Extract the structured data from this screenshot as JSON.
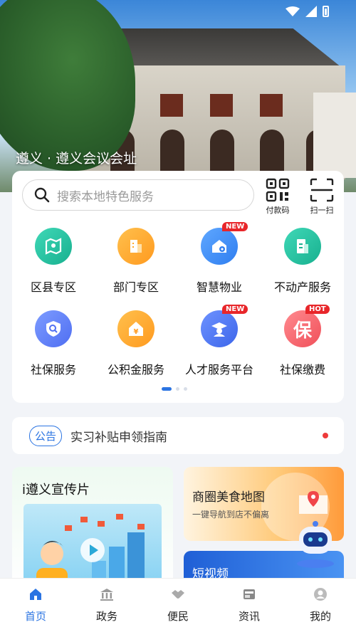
{
  "hero": {
    "caption": "遵义 · 遵义会议会址"
  },
  "search": {
    "placeholder": "搜索本地特色服务"
  },
  "tools": [
    {
      "label": "付款码",
      "icon": "qr-code-icon"
    },
    {
      "label": "扫一扫",
      "icon": "scan-icon"
    }
  ],
  "services": [
    {
      "label": "区县专区",
      "icon": "map-icon",
      "color": "#22c1a0"
    },
    {
      "label": "部门专区",
      "icon": "building-icon",
      "color": "#ffa726"
    },
    {
      "label": "智慧物业",
      "icon": "smart-property-icon",
      "color": "#3d8ef2",
      "badge": "NEW"
    },
    {
      "label": "不动产服务",
      "icon": "property-doc-icon",
      "color": "#22c1a0"
    },
    {
      "label": "社保服务",
      "icon": "shield-search-icon",
      "color": "#5b7ef5"
    },
    {
      "label": "公积金服务",
      "icon": "house-yen-icon",
      "color": "#ffa726"
    },
    {
      "label": "人才服务平台",
      "icon": "graduate-icon",
      "color": "#4a78f0",
      "badge": "NEW"
    },
    {
      "label": "社保缴费",
      "icon": "bao-icon",
      "color": "#f5606a",
      "badge": "HOT",
      "glyph": "保"
    }
  ],
  "notice": {
    "tag": "公告",
    "text": "实习补贴申领指南"
  },
  "promos": {
    "video": {
      "title": "i遵义宣传片"
    },
    "food": {
      "title": "商圈美食地图",
      "subtitle": "一键导航到店不偏离"
    },
    "short": {
      "title": "短视频"
    }
  },
  "nav": [
    {
      "label": "首页",
      "icon": "home-icon",
      "active": true
    },
    {
      "label": "政务",
      "icon": "government-icon"
    },
    {
      "label": "便民",
      "icon": "handshake-icon"
    },
    {
      "label": "资讯",
      "icon": "news-icon"
    },
    {
      "label": "我的",
      "icon": "profile-icon"
    }
  ],
  "colors": {
    "accent": "#2b74e2",
    "badge": "#e8262a"
  }
}
